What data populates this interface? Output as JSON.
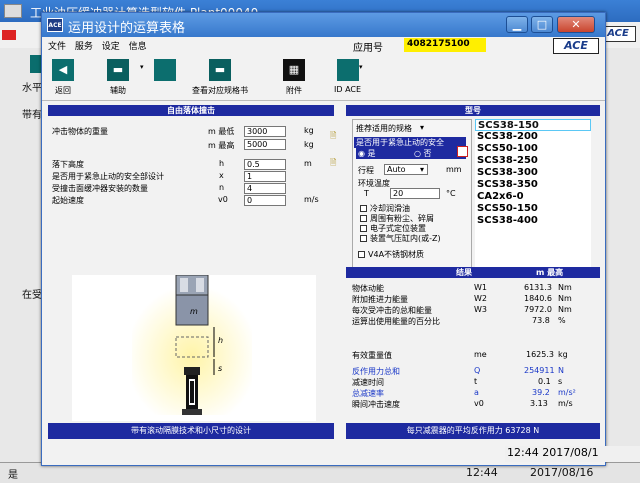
{
  "background_window": {
    "title": "工业油压缓冲器计算选型软件 Plant00040",
    "text_1": "水平",
    "text_2": "带有",
    "text_3": "在受",
    "status_left": "是",
    "time": "12:44",
    "date": "2017/08/16",
    "ace_logo": "ACE"
  },
  "window": {
    "title": "运用设计的运算表格",
    "logo_text": "ACE",
    "min_btn": "▁",
    "max_btn": "□",
    "close_btn": "✕"
  },
  "menu": {
    "items": [
      "文件",
      "服务",
      "设定",
      "信息"
    ],
    "app_no_label": "应用号",
    "app_no_value": "4082175100",
    "ace_logo": "ACE"
  },
  "toolbar": {
    "back": "返回",
    "assist": "辅助",
    "catalog": "查看对应规格书",
    "attach": "附件",
    "idace": "ID ACE"
  },
  "left": {
    "header": "自由落体撞击",
    "mass_label": "冲击物体的重量",
    "mass_min_label": "m 最低",
    "mass_min_value": "3000",
    "mass_max_label": "m 最高",
    "mass_max_value": "5000",
    "mass_unit": "kg",
    "drop_label": "落下高度",
    "drop_sym": "h",
    "drop_value": "0.5",
    "drop_unit": "m",
    "estop_label": "是否用于紧急止动的安全部设计",
    "estop_sym": "x",
    "estop_value": "1",
    "count_label": "受撞击面缓冲器安装的数量",
    "count_sym": "n",
    "count_value": "4",
    "speed_label": "起始速度",
    "speed_sym": "v0",
    "speed_value": "0",
    "speed_unit": "m/s",
    "illus_labels": {
      "m": "m",
      "h": "h",
      "s": "s"
    },
    "bottom_bar": "带有滚动隔膜技术和小尺寸的设计"
  },
  "right": {
    "header": "型号",
    "rec_label": "推荐适用的规格",
    "estop_q": "是否用于紧急止动的安全",
    "yes": "是",
    "no": "否",
    "stroke_label": "行程",
    "stroke_value": "Auto",
    "stroke_unit": "mm",
    "env_label": "环境温度",
    "temp_sym": "T",
    "temp_value": "20",
    "temp_unit": "°C",
    "opts": [
      "冷却润滑油",
      "周围有粉尘、碎屑",
      "电子式定位装置",
      "装置气压缸内(或-Z)"
    ],
    "v4a": "V4A不锈钢材质",
    "models": [
      "SCS38-150",
      "SCS38-200",
      "SCS50-100",
      "SCS38-250",
      "SCS38-300",
      "SCS38-350",
      "CA2x6-0",
      "SCS50-150",
      "SCS38-400"
    ],
    "results_header": "结果",
    "results_header_right": "m 最高",
    "results": [
      {
        "label": "物体动能",
        "sym": "W1",
        "value": "6131.3",
        "unit": "Nm"
      },
      {
        "label": "附加推进力能量",
        "sym": "W2",
        "value": "1840.6",
        "unit": "Nm"
      },
      {
        "label": "每次受冲击的总和能量",
        "sym": "W3",
        "value": "7972.0",
        "unit": "Nm"
      },
      {
        "label": "运算出使用能量的百分比",
        "sym": "",
        "value": "73.8",
        "unit": "%"
      }
    ],
    "eff_mass_label": "有效重量值",
    "eff_mass_sym": "me",
    "eff_mass_value": "1625.3",
    "eff_mass_unit": "kg",
    "results2": [
      {
        "label": "反作用力总和",
        "sym": "Q",
        "value": "254911",
        "unit": "N"
      },
      {
        "label": "减速时间",
        "sym": "t",
        "value": "0.1",
        "unit": "s"
      },
      {
        "label": "总减速率",
        "sym": "a",
        "value": "39.2",
        "unit": "m/s²"
      },
      {
        "label": "瞬间冲击速度",
        "sym": "v0",
        "value": "3.13",
        "unit": "m/s"
      }
    ],
    "bottom_bar": "每只减震器的平均反作用力 63728 N"
  },
  "taskbar_overlay": {
    "datetime": "12:44 2017/08/1"
  }
}
